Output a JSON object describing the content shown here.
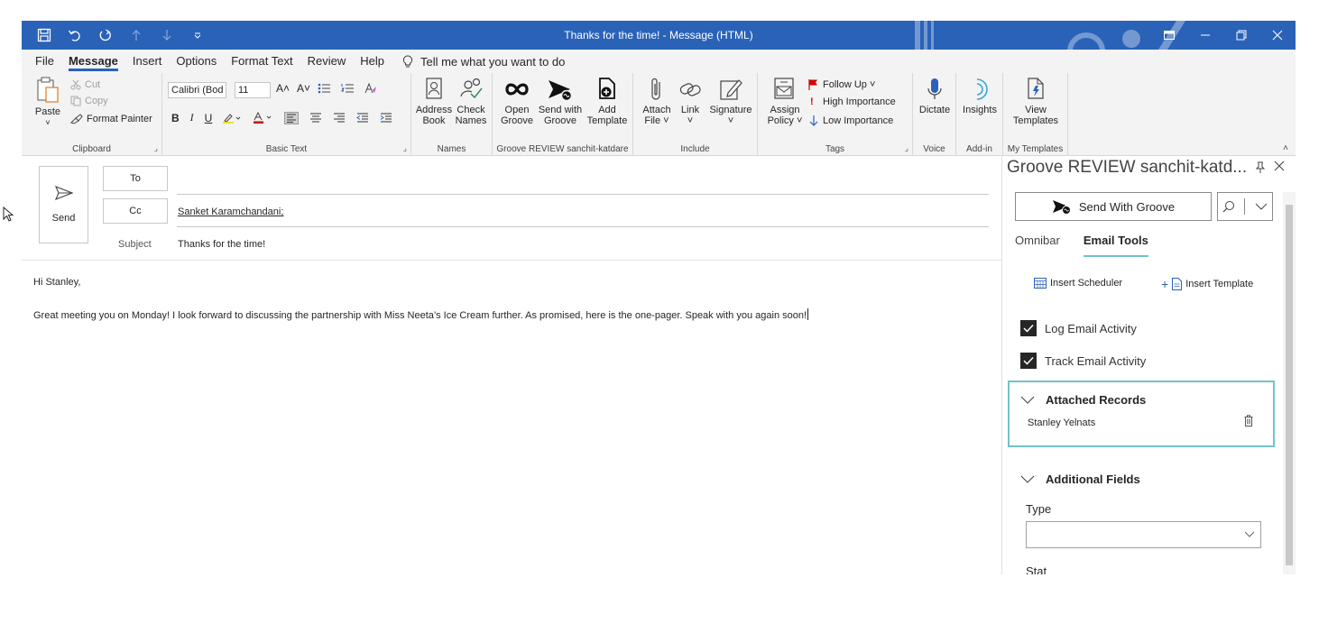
{
  "window": {
    "title": "Thanks for the time!  -  Message (HTML)",
    "colors": {
      "titlebar": "#2a62b8",
      "ribbon": "#f3f3f3",
      "accent_teal": "#72c3c7"
    }
  },
  "menu": {
    "tabs": [
      "File",
      "Message",
      "Insert",
      "Options",
      "Format Text",
      "Review",
      "Help"
    ],
    "active_tab": "Message",
    "tell_me": "Tell me what you want to do"
  },
  "ribbon": {
    "clipboard": {
      "paste": "Paste",
      "cut": "Cut",
      "copy": "Copy",
      "format_painter": "Format Painter",
      "label": "Clipboard"
    },
    "basic_text": {
      "font_name": "Calibri (Bod",
      "font_size": "11",
      "label": "Basic Text"
    },
    "names": {
      "address_book": [
        "Address",
        "Book"
      ],
      "check_names": [
        "Check",
        "Names"
      ],
      "label": "Names"
    },
    "groove": {
      "open": [
        "Open",
        "Groove"
      ],
      "send_with": [
        "Send with",
        "Groove"
      ],
      "add_template": [
        "Add",
        "Template"
      ],
      "label": "Groove REVIEW sanchit-katdare"
    },
    "include": {
      "attach": [
        "Attach",
        "File ˅"
      ],
      "link": [
        "Link",
        "˅"
      ],
      "signature": [
        "Signature",
        "˅"
      ],
      "label": "Include"
    },
    "tags": {
      "assign_policy": [
        "Assign",
        "Policy ˅"
      ],
      "follow_up": "Follow Up ˅",
      "high_importance": "High Importance",
      "low_importance": "Low Importance",
      "label": "Tags"
    },
    "voice": {
      "dictate": "Dictate",
      "label": "Voice"
    },
    "addin": {
      "insights": "Insights",
      "label": "Add-in"
    },
    "templates": {
      "view": [
        "View",
        "Templates"
      ],
      "label": "My Templates"
    }
  },
  "compose": {
    "send_label": "Send",
    "to_label": "To",
    "cc_label": "Cc",
    "cc_value": "Sanket Karamchandani;",
    "subject_label": "Subject",
    "subject_value": "Thanks for the time!",
    "body": [
      "Hi Stanley,",
      "Great meeting you on Monday! I look forward to discussing the partnership with Miss Neeta’s Ice Cream further. As promised, here is the one-pager. Speak with you again soon!"
    ]
  },
  "groove_panel": {
    "title": "Groove REVIEW sanchit-katd...",
    "send_button": "Send With Groove",
    "tabs": [
      "Omnibar",
      "Email Tools"
    ],
    "active_tab": "Email Tools",
    "insert_scheduler": "Insert Scheduler",
    "insert_template": "Insert Template",
    "log_email": "Log Email Activity",
    "track_email": "Track Email Activity",
    "log_email_checked": true,
    "track_email_checked": true,
    "attached_records_title": "Attached Records",
    "attached_record_name": "Stanley Yelnats",
    "additional_fields_title": "Additional Fields",
    "type_label": "Type",
    "type_value": "",
    "next_field_label": "Stat"
  }
}
